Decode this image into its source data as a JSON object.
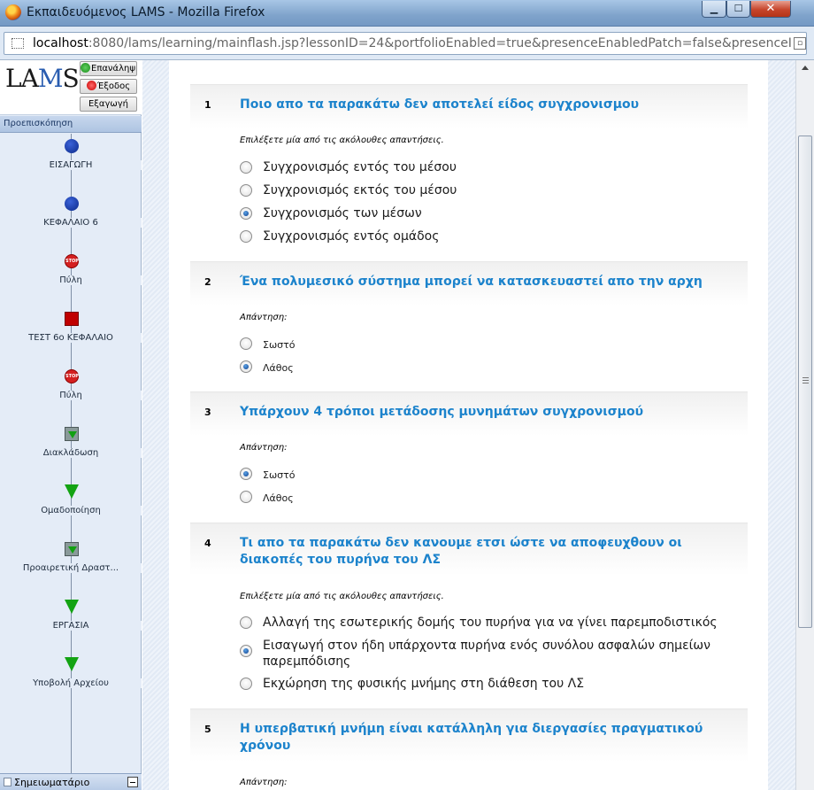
{
  "window": {
    "title": "Εκπαιδευόμενος LAMS - Mozilla Firefox",
    "minimize": "▁",
    "maximize": "☐",
    "close": "✕"
  },
  "address": {
    "host": "localhost",
    "rest": ":8080/lams/learning/mainflash.jsp?lessonID=24&portfolioEnabled=true&presenceEnabledPatch=false&presenceImEna"
  },
  "sidebar": {
    "logo": "LAMS",
    "buttons": {
      "repeat": "Επανάληψη",
      "exit": "Έξοδος",
      "export": "Εξαγωγή"
    },
    "preview_header": "Προεπισκόπηση",
    "activities": [
      {
        "label": "ΕΙΣΑΓΩΓΗ",
        "kind": "circle"
      },
      {
        "label": "ΚΕΦΑΛΑΙΟ 6",
        "kind": "circle"
      },
      {
        "label": "Πύλη",
        "kind": "stop",
        "stop_text": "STOP"
      },
      {
        "label": "ΤΕΣΤ 6ο ΚΕΦΑΛΑΙΟ",
        "kind": "square"
      },
      {
        "label": "Πύλη",
        "kind": "stop",
        "stop_text": "STOP"
      },
      {
        "label": "Διακλάδωση",
        "kind": "branch"
      },
      {
        "label": "Ομαδοποίηση",
        "kind": "tri"
      },
      {
        "label": "Προαιρετική Δραστ...",
        "kind": "branch"
      },
      {
        "label": "ΕΡΓΑΣΙΑ",
        "kind": "tri"
      },
      {
        "label": "Υποβολή Αρχείου",
        "kind": "tri"
      }
    ],
    "notebook": "Σημειωματάριο"
  },
  "questions": [
    {
      "number": "1",
      "title": "Ποιο απο τα παρακάτω δεν αποτελεί είδος συγχρονισμου",
      "instruction": "Επιλέξετε μία από τις ακόλουθες απαντήσεις.",
      "options": [
        {
          "text": "Συγχρονισμός εντός του μέσου",
          "checked": false
        },
        {
          "text": "Συγχρονισμός εκτός του μέσου",
          "checked": false
        },
        {
          "text": "Συγχρονισμός των μέσων",
          "checked": true
        },
        {
          "text": "Συγχρονισμός εντός ομάδος",
          "checked": false
        }
      ]
    },
    {
      "number": "2",
      "title": "Ένα πολυμεσικό σύστημα μπορεί να κατασκευαστεί απο την αρχη",
      "instruction": "Απάντηση:",
      "options": [
        {
          "text": "Σωστό",
          "checked": false
        },
        {
          "text": "Λάθος",
          "checked": true
        }
      ]
    },
    {
      "number": "3",
      "title": "Υπάρχουν 4 τρόποι μετάδοσης μυνημάτων συγχρονισμού",
      "instruction": "Απάντηση:",
      "options": [
        {
          "text": "Σωστό",
          "checked": true
        },
        {
          "text": "Λάθος",
          "checked": false
        }
      ]
    },
    {
      "number": "4",
      "title": "Τι απο τα παρακάτω δεν κανουμε ετσι ώστε να αποφευχθουν οι διακοπές του πυρήνα του ΛΣ",
      "instruction": "Επιλέξετε μία από τις ακόλουθες απαντήσεις.",
      "options": [
        {
          "text": "Αλλαγή της εσωτερικής δομής του πυρήνα για να γίνει παρεμποδιστικός",
          "checked": false
        },
        {
          "text": "Εισαγωγή στον ήδη υπάρχοντα πυρήνα ενός συνόλου ασφαλών σημείων παρεμπόδισης",
          "checked": true
        },
        {
          "text": "Εκχώρηση της φυσικής μνήμης στη διάθεση του ΛΣ",
          "checked": false
        }
      ]
    },
    {
      "number": "5",
      "title": "Η υπερβατική μνήμη είναι κατάλληλη για διεργασίες πραγματικού χρόνου",
      "instruction": "Απάντηση:",
      "options": []
    }
  ]
}
